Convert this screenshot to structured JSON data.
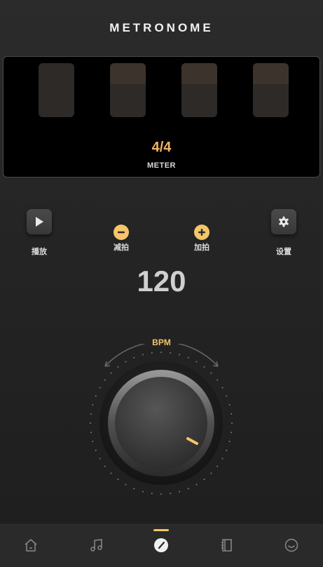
{
  "app": {
    "title": "METRONOME"
  },
  "meter": {
    "value": "4/4",
    "label": "METER",
    "beats": 4
  },
  "controls": {
    "play_label": "播放",
    "decrease_label": "减拍",
    "increase_label": "加拍",
    "settings_label": "设置"
  },
  "tempo": {
    "bpm": "120",
    "unit": "BPM"
  },
  "tabs": [
    {
      "name": "home",
      "active": false
    },
    {
      "name": "music",
      "active": false
    },
    {
      "name": "metronome",
      "active": true
    },
    {
      "name": "notebook",
      "active": false
    },
    {
      "name": "profile",
      "active": false
    }
  ],
  "colors": {
    "accent": "#f5c56a",
    "meter_text": "#f2b562",
    "background": "#262626"
  }
}
